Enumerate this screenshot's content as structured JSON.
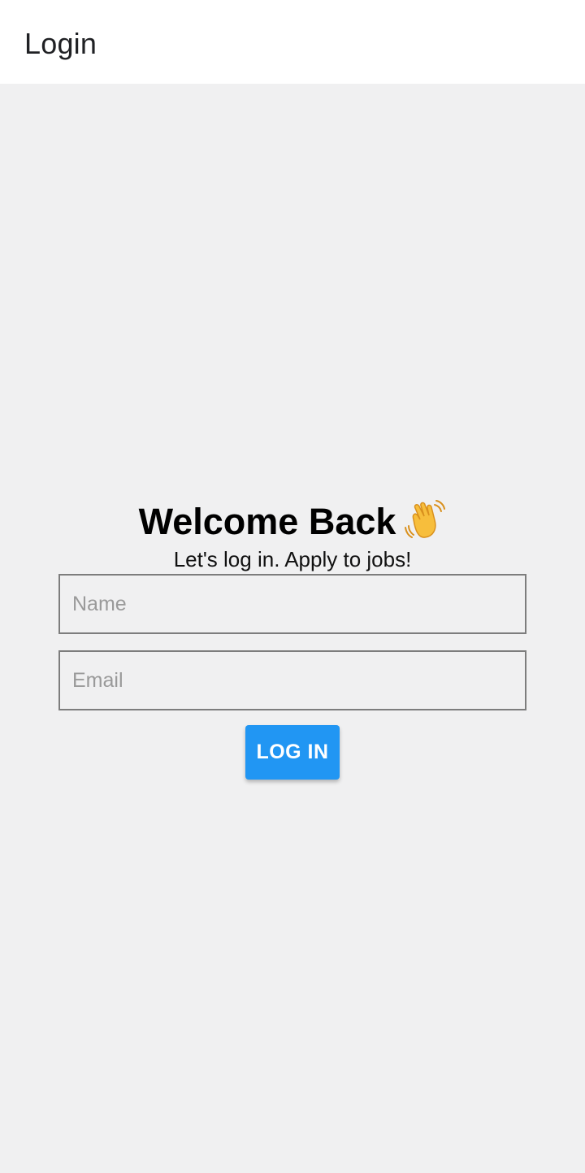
{
  "app_bar": {
    "title": "Login"
  },
  "login": {
    "heading": "Welcome Back",
    "heading_icon": "waving-hand-icon",
    "subheading": "Let's log in. Apply to jobs!",
    "name_field": {
      "value": "",
      "placeholder": "Name"
    },
    "email_field": {
      "value": "",
      "placeholder": "Email"
    },
    "button_label": "LOG IN"
  },
  "colors": {
    "background": "#f0f0f1",
    "app_bar": "#ffffff",
    "accent": "#2196f3",
    "field_border": "#7d7d7d",
    "placeholder": "#9a9a9a"
  }
}
